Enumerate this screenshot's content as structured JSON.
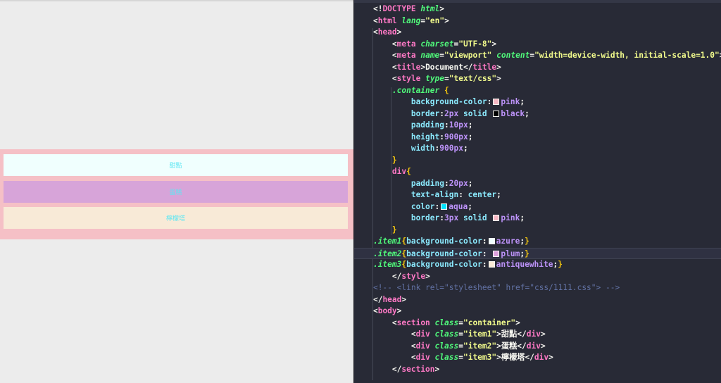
{
  "preview": {
    "items": [
      {
        "label": "甜點",
        "bg": "#f0fffe"
      },
      {
        "label": "蛋糕",
        "bg": "#d7a4d9"
      },
      {
        "label": "檸檬塔",
        "bg": "#f8ead7"
      }
    ],
    "container_bg": "#f5c0c6",
    "text_color": "#5ee6f2"
  },
  "editor": {
    "theme": "dracula",
    "lines": [
      {
        "indent": "    ",
        "tokens": [
          [
            "t-punc",
            "<!"
          ],
          [
            "t-tag",
            "DOCTYPE"
          ],
          [
            "t-punc",
            " "
          ],
          [
            "t-attr",
            "html"
          ],
          [
            "t-punc",
            ">"
          ]
        ]
      },
      {
        "indent": "    ",
        "tokens": [
          [
            "t-punc",
            "<"
          ],
          [
            "t-tag",
            "html"
          ],
          [
            "t-punc",
            " "
          ],
          [
            "t-attr",
            "lang"
          ],
          [
            "t-punc",
            "="
          ],
          [
            "t-str",
            "\"en\""
          ],
          [
            "t-punc",
            ">"
          ]
        ]
      },
      {
        "indent": "    ",
        "tokens": [
          [
            "t-punc",
            "<"
          ],
          [
            "t-tag",
            "head"
          ],
          [
            "t-punc",
            ">"
          ]
        ]
      },
      {
        "indent": "        ",
        "tokens": [
          [
            "t-punc",
            "<"
          ],
          [
            "t-tag",
            "meta"
          ],
          [
            "t-punc",
            " "
          ],
          [
            "t-attr",
            "charset"
          ],
          [
            "t-punc",
            "="
          ],
          [
            "t-str",
            "\"UTF-8\""
          ],
          [
            "t-punc",
            ">"
          ]
        ]
      },
      {
        "indent": "        ",
        "tokens": [
          [
            "t-punc",
            "<"
          ],
          [
            "t-tag",
            "meta"
          ],
          [
            "t-punc",
            " "
          ],
          [
            "t-attr",
            "name"
          ],
          [
            "t-punc",
            "="
          ],
          [
            "t-str",
            "\"viewport\""
          ],
          [
            "t-punc",
            " "
          ],
          [
            "t-attr",
            "content"
          ],
          [
            "t-punc",
            "="
          ],
          [
            "t-str",
            "\"width=device-width, initial-scale=1.0\""
          ],
          [
            "t-punc",
            ">"
          ]
        ]
      },
      {
        "indent": "        ",
        "tokens": [
          [
            "t-punc",
            "<"
          ],
          [
            "t-tag",
            "title"
          ],
          [
            "t-punc",
            ">Document</"
          ],
          [
            "t-tag",
            "title"
          ],
          [
            "t-punc",
            ">"
          ]
        ]
      },
      {
        "indent": "        ",
        "tokens": [
          [
            "t-punc",
            "<"
          ],
          [
            "t-tag",
            "style"
          ],
          [
            "t-punc",
            " "
          ],
          [
            "t-attr",
            "type"
          ],
          [
            "t-punc",
            "="
          ],
          [
            "t-str",
            "\"text/css\""
          ],
          [
            "t-punc",
            ">"
          ]
        ]
      },
      {
        "indent": "        ",
        "tokens": [
          [
            "t-sel",
            ".container"
          ],
          [
            "t-punc",
            " "
          ],
          [
            "t-brace",
            "{"
          ]
        ]
      },
      {
        "indent": "            ",
        "tokens": [
          [
            "t-prop",
            "background-color"
          ],
          [
            "t-punc",
            ":"
          ],
          [
            "swatch",
            "#f7b8c4"
          ],
          [
            "t-val",
            "pink"
          ],
          [
            "t-punc",
            ";"
          ]
        ]
      },
      {
        "indent": "            ",
        "tokens": [
          [
            "t-prop",
            "border"
          ],
          [
            "t-punc",
            ":"
          ],
          [
            "t-val",
            "2px"
          ],
          [
            "t-punc",
            " "
          ],
          [
            "t-prop",
            "solid"
          ],
          [
            "t-punc",
            " "
          ],
          [
            "swatch",
            "#000000"
          ],
          [
            "t-val",
            "black"
          ],
          [
            "t-punc",
            ";"
          ]
        ]
      },
      {
        "indent": "            ",
        "tokens": [
          [
            "t-prop",
            "padding"
          ],
          [
            "t-punc",
            ":"
          ],
          [
            "t-val",
            "10px"
          ],
          [
            "t-punc",
            ";"
          ]
        ]
      },
      {
        "indent": "            ",
        "tokens": [
          [
            "t-prop",
            "height"
          ],
          [
            "t-punc",
            ":"
          ],
          [
            "t-val",
            "900px"
          ],
          [
            "t-punc",
            ";"
          ]
        ]
      },
      {
        "indent": "            ",
        "tokens": [
          [
            "t-prop",
            "width"
          ],
          [
            "t-punc",
            ":"
          ],
          [
            "t-val",
            "900px"
          ],
          [
            "t-punc",
            ";"
          ]
        ]
      },
      {
        "indent": "        ",
        "tokens": [
          [
            "t-brace",
            "}"
          ]
        ]
      },
      {
        "indent": "        ",
        "tokens": [
          [
            "t-tag",
            "div"
          ],
          [
            "t-brace",
            "{"
          ]
        ]
      },
      {
        "indent": "            ",
        "tokens": [
          [
            "t-prop",
            "padding"
          ],
          [
            "t-punc",
            ":"
          ],
          [
            "t-val",
            "20px"
          ],
          [
            "t-punc",
            ";"
          ]
        ]
      },
      {
        "indent": "            ",
        "tokens": [
          [
            "t-prop",
            "text-align"
          ],
          [
            "t-punc",
            ": "
          ],
          [
            "t-prop",
            "center"
          ],
          [
            "t-punc",
            ";"
          ]
        ]
      },
      {
        "indent": "            ",
        "tokens": [
          [
            "t-prop",
            "color"
          ],
          [
            "t-punc",
            ":"
          ],
          [
            "swatch",
            "#00e5ff"
          ],
          [
            "t-val",
            "aqua"
          ],
          [
            "t-punc",
            ";"
          ]
        ]
      },
      {
        "indent": "            ",
        "tokens": [
          [
            "t-prop",
            "border"
          ],
          [
            "t-punc",
            ":"
          ],
          [
            "t-val",
            "3px"
          ],
          [
            "t-punc",
            " "
          ],
          [
            "t-prop",
            "solid"
          ],
          [
            "t-punc",
            " "
          ],
          [
            "swatch",
            "#f7b8c4"
          ],
          [
            "t-val",
            "pink"
          ],
          [
            "t-punc",
            ";"
          ]
        ]
      },
      {
        "indent": "        ",
        "tokens": [
          [
            "t-brace",
            "}"
          ]
        ]
      },
      {
        "indent": "    ",
        "tokens": [
          [
            "t-sel",
            ".item1"
          ],
          [
            "t-brace",
            "{"
          ],
          [
            "t-prop",
            "background-color"
          ],
          [
            "t-punc",
            ":"
          ],
          [
            "swatch",
            "#f0ffff"
          ],
          [
            "t-val",
            "azure"
          ],
          [
            "t-punc",
            ";"
          ],
          [
            "t-brace",
            "}"
          ]
        ]
      },
      {
        "indent": "    ",
        "hl": true,
        "tokens": [
          [
            "t-sel",
            ".item2"
          ],
          [
            "t-brace",
            "{"
          ],
          [
            "t-prop",
            "background-color"
          ],
          [
            "t-punc",
            ": "
          ],
          [
            "swatch",
            "#dda0dd"
          ],
          [
            "t-val",
            "plum"
          ],
          [
            "t-punc",
            ";"
          ],
          [
            "t-brace",
            "}"
          ]
        ]
      },
      {
        "indent": "    ",
        "tokens": [
          [
            "t-sel",
            ".item3"
          ],
          [
            "t-brace",
            "{"
          ],
          [
            "t-prop",
            "background-color"
          ],
          [
            "t-punc",
            ":"
          ],
          [
            "swatch",
            "#faebd7"
          ],
          [
            "t-val",
            "antiquewhite"
          ],
          [
            "t-punc",
            ";"
          ],
          [
            "t-brace",
            "}"
          ]
        ]
      },
      {
        "indent": "        ",
        "tokens": [
          [
            "t-punc",
            "</"
          ],
          [
            "t-tag",
            "style"
          ],
          [
            "t-punc",
            ">"
          ]
        ]
      },
      {
        "indent": "    ",
        "tokens": [
          [
            "t-cmt",
            "<!-- <link rel=\"stylesheet\" href=\"css/1111.css\"> -->"
          ]
        ]
      },
      {
        "indent": "    ",
        "tokens": [
          [
            "t-punc",
            "</"
          ],
          [
            "t-tag",
            "head"
          ],
          [
            "t-punc",
            ">"
          ]
        ]
      },
      {
        "indent": "    ",
        "tokens": [
          [
            "t-punc",
            "<"
          ],
          [
            "t-tag",
            "body"
          ],
          [
            "t-punc",
            ">"
          ]
        ]
      },
      {
        "indent": "        ",
        "tokens": [
          [
            "t-punc",
            "<"
          ],
          [
            "t-tag",
            "section"
          ],
          [
            "t-punc",
            " "
          ],
          [
            "t-attr",
            "class"
          ],
          [
            "t-punc",
            "="
          ],
          [
            "t-str",
            "\"container\""
          ],
          [
            "t-punc",
            ">"
          ]
        ]
      },
      {
        "indent": "            ",
        "tokens": [
          [
            "t-punc",
            "<"
          ],
          [
            "t-tag",
            "div"
          ],
          [
            "t-punc",
            " "
          ],
          [
            "t-attr",
            "class"
          ],
          [
            "t-punc",
            "="
          ],
          [
            "t-str",
            "\"item1\""
          ],
          [
            "t-punc",
            ">甜點</"
          ],
          [
            "t-tag",
            "div"
          ],
          [
            "t-punc",
            ">"
          ]
        ]
      },
      {
        "indent": "            ",
        "tokens": [
          [
            "t-punc",
            "<"
          ],
          [
            "t-tag",
            "div"
          ],
          [
            "t-punc",
            " "
          ],
          [
            "t-attr",
            "class"
          ],
          [
            "t-punc",
            "="
          ],
          [
            "t-str",
            "\"item2\""
          ],
          [
            "t-punc",
            ">蛋糕</"
          ],
          [
            "t-tag",
            "div"
          ],
          [
            "t-punc",
            ">"
          ]
        ]
      },
      {
        "indent": "            ",
        "tokens": [
          [
            "t-punc",
            "<"
          ],
          [
            "t-tag",
            "div"
          ],
          [
            "t-punc",
            " "
          ],
          [
            "t-attr",
            "class"
          ],
          [
            "t-punc",
            "="
          ],
          [
            "t-str",
            "\"item3\""
          ],
          [
            "t-punc",
            ">檸檬塔</"
          ],
          [
            "t-tag",
            "div"
          ],
          [
            "t-punc",
            ">"
          ]
        ]
      },
      {
        "indent": "        ",
        "tokens": [
          [
            "t-punc",
            "</"
          ],
          [
            "t-tag",
            "section"
          ],
          [
            "t-punc",
            ">"
          ]
        ]
      }
    ]
  }
}
